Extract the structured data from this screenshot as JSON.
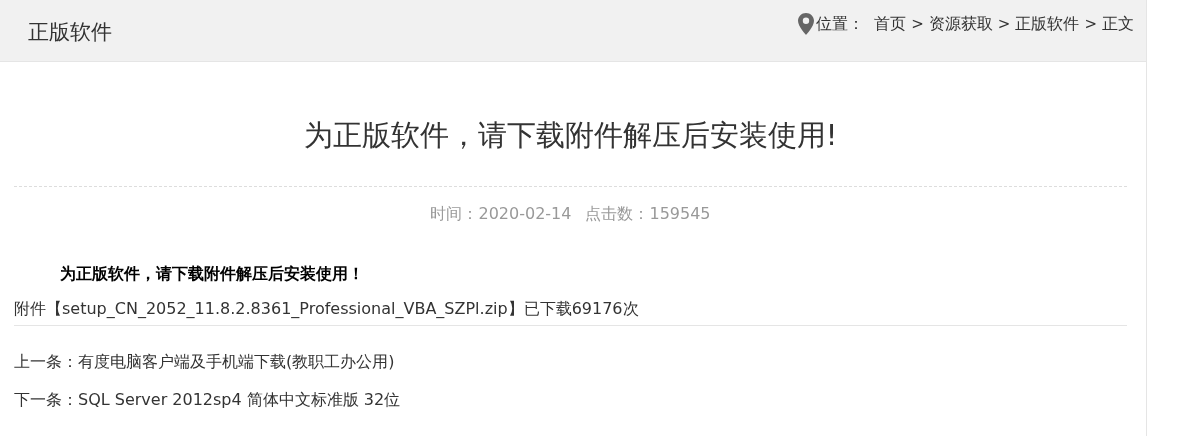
{
  "header": {
    "title": "正版软件",
    "location_label": "位置：",
    "breadcrumb": [
      {
        "kind": "link",
        "text": "首页"
      },
      {
        "kind": "separator",
        "text": ">"
      },
      {
        "kind": "link",
        "text": "资源获取"
      },
      {
        "kind": "separator",
        "text": ">"
      },
      {
        "kind": "link",
        "text": "正版软件"
      },
      {
        "kind": "separator",
        "text": ">"
      },
      {
        "kind": "link",
        "text": "正文"
      }
    ]
  },
  "article": {
    "title": "为正版软件，请下载附件解压后安装使用!",
    "meta": [
      "时间：2020-02-14",
      "点击数：159545"
    ],
    "body": "为正版软件，请下载附件解压后安装使用！",
    "attachment": {
      "prefix": "附件【",
      "file": "setup_CN_2052_11.8.2.8361_Professional_VBA_SZPl.zip",
      "suffix": "】已下载69176次"
    }
  },
  "navigation": [
    {
      "label": "上一条：",
      "link": "有度电脑客户端及手机端下载(教职工办公用)"
    },
    {
      "label": "下一条：",
      "link": "SQL Server 2012sp4 简体中文标准版 32位"
    }
  ]
}
